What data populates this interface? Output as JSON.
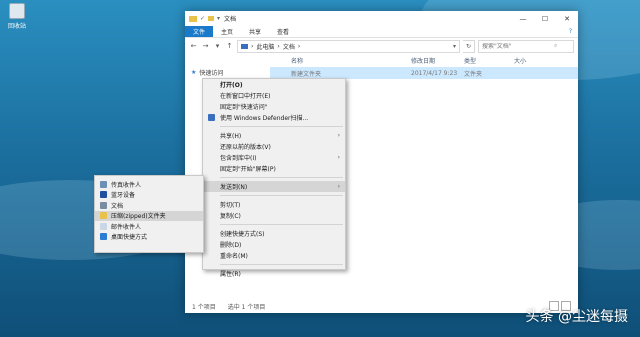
{
  "desktop": {
    "recycle_bin_label": "回收站"
  },
  "window": {
    "title": "文档",
    "controls": {
      "minimize": "—",
      "maximize": "☐",
      "close": "✕"
    },
    "ribbon": {
      "tabs": [
        "文件",
        "主页",
        "共享",
        "查看"
      ]
    },
    "address": {
      "crumbs": [
        "此电脑",
        "文档"
      ]
    },
    "search": {
      "placeholder": "搜索\"文档\""
    },
    "nav_pane": {
      "quick_access": "快速访问"
    },
    "columns": [
      "名称",
      "修改日期",
      "类型",
      "大小"
    ],
    "files": [
      {
        "name": "新建文件夹",
        "modified": "2017/4/17 9:23",
        "type": "文件夹"
      }
    ],
    "status": {
      "item_count": "1 个项目",
      "selected": "选中 1 个项目"
    }
  },
  "context_menu": {
    "items": [
      {
        "label": "打开(O)",
        "bold": true
      },
      {
        "label": "在新窗口中打开(E)"
      },
      {
        "label": "固定到\"快速访问\""
      },
      {
        "label": "使用 Windows Defender扫描...",
        "icon": "defender-icon"
      },
      {
        "sep": true
      },
      {
        "label": "共享(H)",
        "submenu": true
      },
      {
        "label": "还原以前的版本(V)"
      },
      {
        "label": "包含到库中(I)",
        "submenu": true
      },
      {
        "label": "固定到\"开始\"屏幕(P)"
      },
      {
        "sep": true
      },
      {
        "label": "发送到(N)",
        "submenu": true,
        "highlighted": true
      },
      {
        "sep": true
      },
      {
        "label": "剪切(T)"
      },
      {
        "label": "复制(C)"
      },
      {
        "sep": true
      },
      {
        "label": "创建快捷方式(S)"
      },
      {
        "label": "删除(D)"
      },
      {
        "label": "重命名(M)"
      },
      {
        "sep": true
      },
      {
        "label": "属性(R)"
      }
    ]
  },
  "send_to_menu": {
    "items": [
      {
        "label": "传真收件人",
        "icon": "fax-icon",
        "color": "#6b8fb5"
      },
      {
        "label": "蓝牙设备",
        "icon": "bluetooth-icon",
        "color": "#1f4f9e"
      },
      {
        "label": "文档",
        "icon": "documents-icon",
        "color": "#7a8ca0"
      },
      {
        "label": "压缩(zipped)文件夹",
        "icon": "zip-folder-icon",
        "color": "#e8c24a",
        "highlighted": true
      },
      {
        "label": "邮件收件人",
        "icon": "mail-icon",
        "color": "#c9d6e6"
      },
      {
        "label": "桌面快捷方式",
        "icon": "desktop-icon",
        "color": "#2b7cd3"
      }
    ]
  },
  "watermark": {
    "text": "头条 @尘迷每摄"
  },
  "colors": {
    "ribbon_file_tab": "#1979ca",
    "selection": "#cce8ff",
    "menu_bg": "#f0f0f0"
  }
}
